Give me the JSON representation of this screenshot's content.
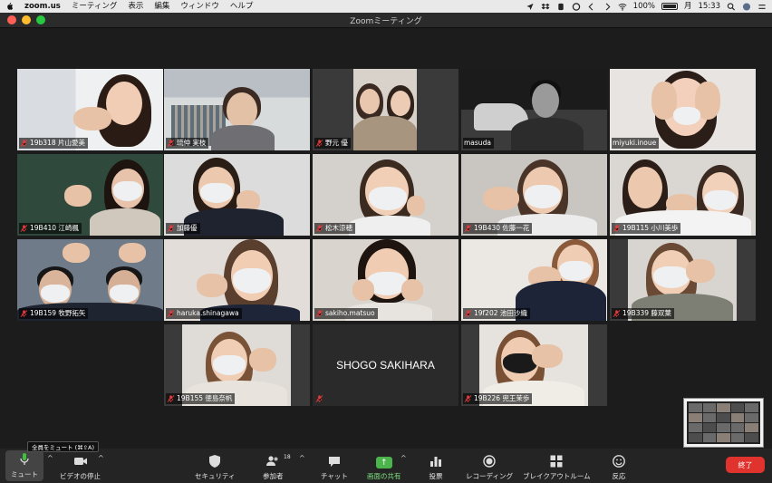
{
  "menubar": {
    "app_name": "zoom.us",
    "items": [
      "ミーティング",
      "表示",
      "編集",
      "ウィンドウ",
      "ヘルプ"
    ],
    "battery": "100%",
    "day": "月",
    "time": "15:33"
  },
  "window": {
    "title": "Zoomミーティング"
  },
  "participants": [
    {
      "name": "19b318 片山愛美",
      "muted": true
    },
    {
      "name": "琉仲 実枝",
      "muted": true,
      "active_speaker": true
    },
    {
      "name": "野元 優",
      "muted": true
    },
    {
      "name": "masuda",
      "muted": false
    },
    {
      "name": "miyuki.inoue",
      "muted": false
    },
    {
      "name": "19B410 江崎楓",
      "muted": true
    },
    {
      "name": "加藤優",
      "muted": true
    },
    {
      "name": "松木涼穂",
      "muted": true
    },
    {
      "name": "19B430 佐藤一花",
      "muted": true
    },
    {
      "name": "19B115 小川美歩",
      "muted": true
    },
    {
      "name": "19B159 牧野拓矢",
      "muted": true
    },
    {
      "name": "haruka.shinagawa",
      "muted": true
    },
    {
      "name": "sakiho.matsuo",
      "muted": true
    },
    {
      "name": "19f202 池田沙織",
      "muted": true
    },
    {
      "name": "19B339 藤双葉",
      "muted": true
    },
    {
      "name": "19B155 徳島奈帆",
      "muted": true
    },
    {
      "name": "SHOGO SAKIHARA",
      "muted": true,
      "video_off": true
    },
    {
      "name": "19B226 兜王茉歩",
      "muted": true
    }
  ],
  "toolbar": {
    "mute_label": "ミュート",
    "video_label": "ビデオの停止",
    "security_label": "セキュリティ",
    "participants_label": "参加者",
    "participants_count": "18",
    "chat_label": "チャット",
    "share_label": "画面の共有",
    "poll_label": "投票",
    "record_label": "レコーディング",
    "breakout_label": "ブレイクアウトルーム",
    "reactions_label": "反応",
    "end_label": "終了",
    "tooltip": "全員をミュート (⌘⇧A)"
  },
  "colors": {
    "active_speaker_border": "#a6d94f",
    "end_button": "#e0332e",
    "share_button": "#4bb54b",
    "muted_icon": "#e23b3b"
  }
}
